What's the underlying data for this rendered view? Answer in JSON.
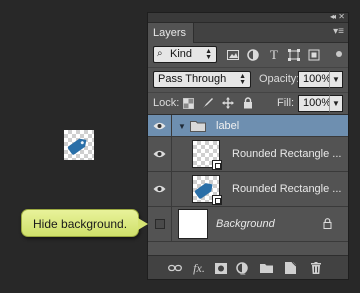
{
  "canvas": {
    "shape_color": "#2a6fa8"
  },
  "panel": {
    "tab_label": "Layers",
    "filter": {
      "kind_label": "Kind"
    },
    "blend": {
      "mode": "Pass Through",
      "opacity_label": "Opacity:",
      "opacity_value": "100%",
      "lock_label": "Lock:",
      "fill_label": "Fill:",
      "fill_value": "100%"
    },
    "layers": [
      {
        "name": "label",
        "type": "group",
        "visible": true,
        "selected": true
      },
      {
        "name": "Rounded Rectangle ...",
        "type": "shape",
        "visible": true
      },
      {
        "name": "Rounded Rectangle ...",
        "type": "shape",
        "visible": true
      },
      {
        "name": "Background",
        "type": "background",
        "visible": false,
        "locked": true
      }
    ],
    "colors": {
      "selected_row": "#6e8fb0",
      "panel_bg": "#535353"
    }
  },
  "tooltip": {
    "text": "Hide background."
  }
}
